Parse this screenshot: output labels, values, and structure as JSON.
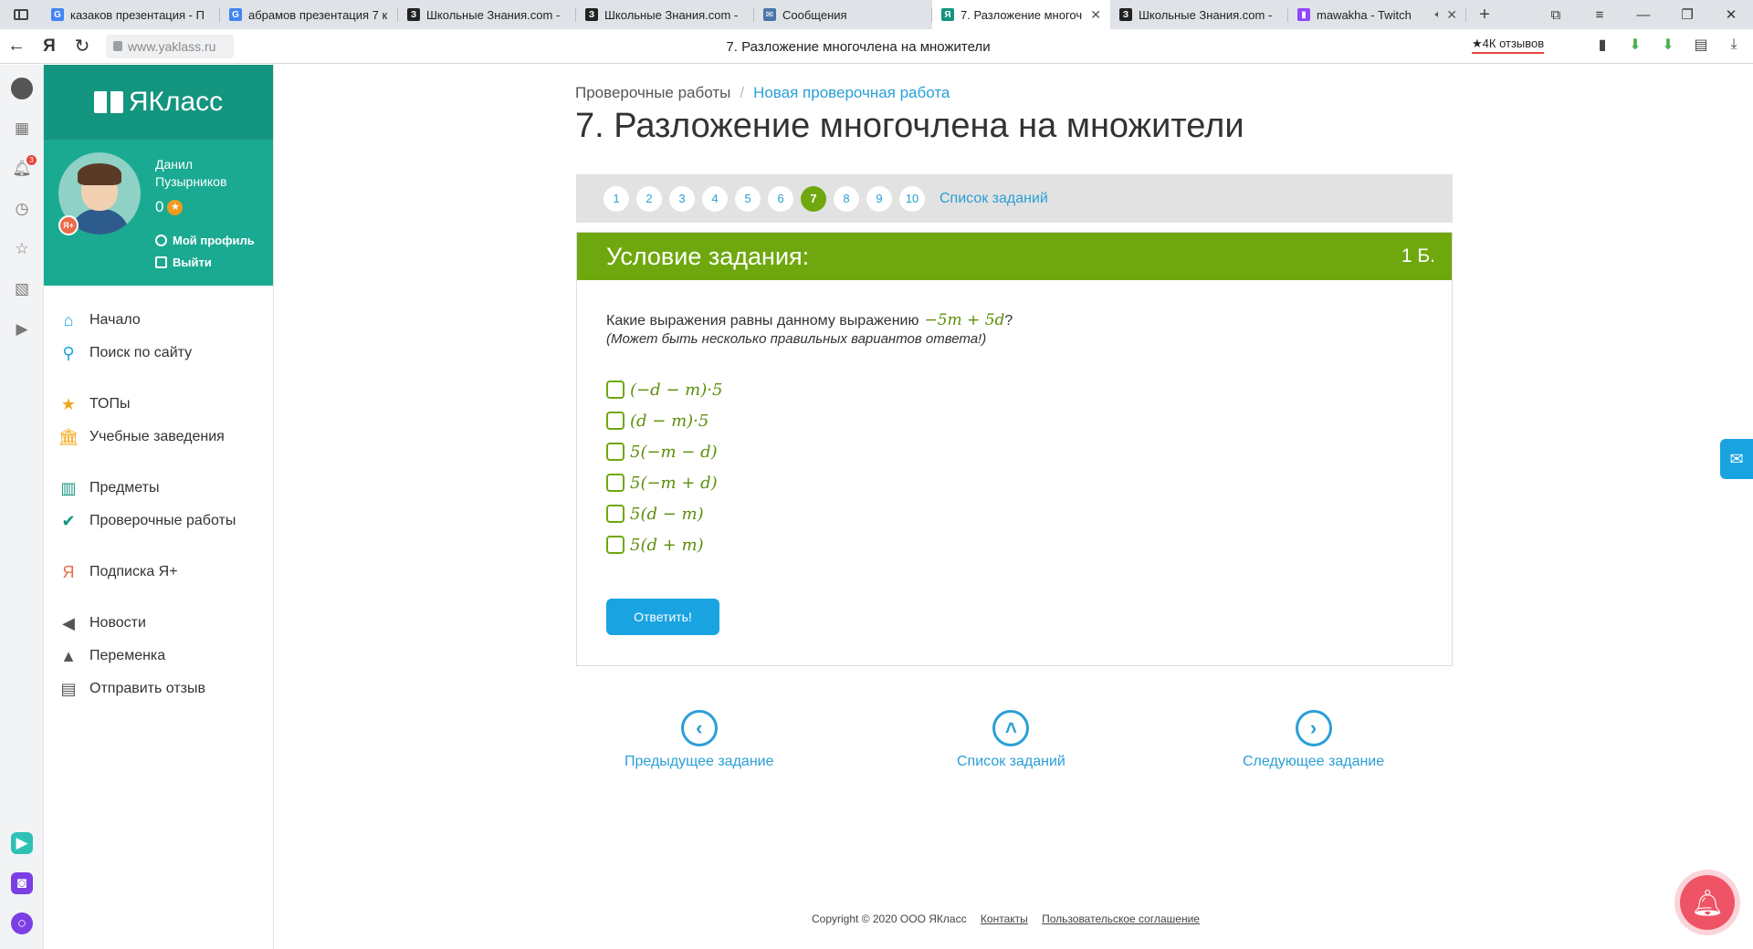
{
  "browser": {
    "tabs": [
      {
        "title": "казаков презентация - П",
        "fav": "G",
        "fav_color": "#4285f4",
        "active": false
      },
      {
        "title": "абрамов презентация 7 к",
        "fav": "G",
        "fav_color": "#4285f4",
        "active": false
      },
      {
        "title": "Школьные Знания.com -",
        "fav": "З",
        "fav_color": "#222222",
        "active": false
      },
      {
        "title": "Школьные Знания.com -",
        "fav": "З",
        "fav_color": "#222222",
        "active": false
      },
      {
        "title": "Сообщения",
        "fav": "✉",
        "fav_color": "#4a76a8",
        "active": false
      },
      {
        "title": "7. Разложение многоч",
        "fav": "Я",
        "fav_color": "#14957f",
        "active": true
      },
      {
        "title": "Школьные Знания.com -",
        "fav": "З",
        "fav_color": "#222222",
        "active": false
      },
      {
        "title": "mawakha - Twitch",
        "fav": "▮",
        "fav_color": "#9146ff",
        "active": false
      }
    ],
    "url": "www.yaklass.ru",
    "page_title": "7. Разложение многочлена на множители",
    "reviews_label": "★4К отзывов"
  },
  "ystrip": {
    "notification_count": "3"
  },
  "sidebar": {
    "logo_text": "ЯКласс",
    "user_name": "Данил Пузырников",
    "score": "0",
    "my_profile": "Мой профиль",
    "logout": "Выйти",
    "items": [
      {
        "label": "Начало",
        "icon": "home-icon",
        "color": "#19a3e1"
      },
      {
        "label": "Поиск по сайту",
        "icon": "search-icon",
        "color": "#19a3e1"
      },
      {
        "label": "ТОПы",
        "icon": "star-icon",
        "color": "#f2a81d"
      },
      {
        "label": "Учебные заведения",
        "icon": "institution-icon",
        "color": "#f2a81d"
      },
      {
        "label": "Предметы",
        "icon": "books-icon",
        "color": "#14957f"
      },
      {
        "label": "Проверочные работы",
        "icon": "check-circle-icon",
        "color": "#14957f"
      },
      {
        "label": "Подписка Я+",
        "icon": "ya-plus-icon",
        "color": "#ea6b4b"
      },
      {
        "label": "Новости",
        "icon": "megaphone-icon",
        "color": "#555555"
      },
      {
        "label": "Переменка",
        "icon": "bell-icon",
        "color": "#555555"
      },
      {
        "label": "Отправить отзыв",
        "icon": "feedback-icon",
        "color": "#555555"
      }
    ]
  },
  "main": {
    "breadcrumb_parent": "Проверочные работы",
    "breadcrumb_separator": "/",
    "breadcrumb_current": "Новая проверочная работа",
    "title": "7. Разложение многочлена на множители",
    "pages": [
      "1",
      "2",
      "3",
      "4",
      "5",
      "6",
      "7",
      "8",
      "9",
      "10"
    ],
    "active_page": "7",
    "task_list_link": "Список заданий",
    "task": {
      "header": "Условие задания:",
      "points": "1 Б.",
      "question": "Какие выражения равны данному выражению",
      "expression": "−5m + 5d",
      "question_end": "?",
      "hint": "(Может быть несколько правильных вариантов ответа!)",
      "options": [
        "(−d − m)·5",
        "(d − m)·5",
        "5(−m − d)",
        "5(−m + d)",
        "5(d − m)",
        "5(d + m)"
      ],
      "submit_label": "Ответить!"
    },
    "nav": {
      "prev": "Предыдущее задание",
      "list": "Список заданий",
      "next": "Следующее задание"
    },
    "footer": {
      "copyright": "Copyright © 2020 ООО ЯКласс",
      "contacts": "Контакты",
      "agreement": "Пользовательское соглашение"
    }
  }
}
